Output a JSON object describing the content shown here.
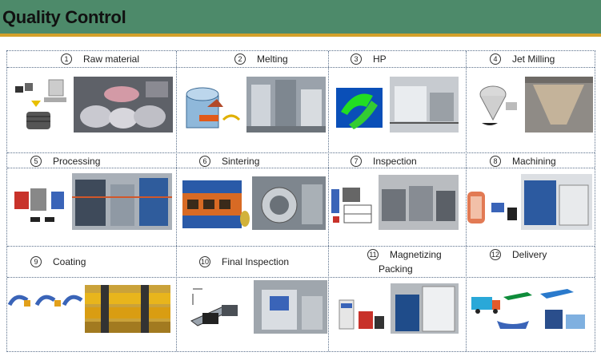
{
  "header": {
    "title": "Quality Control"
  },
  "steps": [
    {
      "num": "1",
      "label": "Raw material"
    },
    {
      "num": "2",
      "label": "Melting"
    },
    {
      "num": "3",
      "label": "HP"
    },
    {
      "num": "4",
      "label": "Jet Milling"
    },
    {
      "num": "5",
      "label": "Processing"
    },
    {
      "num": "6",
      "label": "Sintering"
    },
    {
      "num": "7",
      "label": "Inspection"
    },
    {
      "num": "8",
      "label": "Machining"
    },
    {
      "num": "9",
      "label": "Coating"
    },
    {
      "num": "10",
      "label": "Final Inspection"
    },
    {
      "num": "11",
      "label": "Magnetizing",
      "label2": "Packing"
    },
    {
      "num": "12",
      "label": "Delivery"
    }
  ],
  "colors": {
    "header_bg": "#4d8a6a",
    "header_border": "#d4a02a",
    "grid_border": "#5a6f8a"
  }
}
